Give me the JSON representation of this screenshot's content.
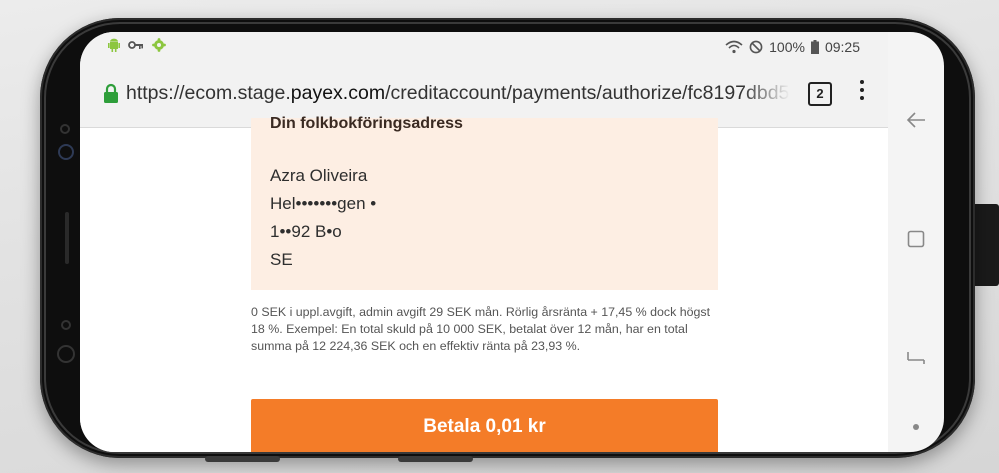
{
  "status_bar": {
    "left_icons": [
      "android-icon",
      "key-icon",
      "settings-icon"
    ],
    "battery": "100%",
    "time": "09:25"
  },
  "browser": {
    "url_prefix": "https://ecom.stage.",
    "url_domain": "payex.com",
    "url_path": "/creditaccount/payments/authorize/fc8197dbd5",
    "tab_count": "2"
  },
  "address": {
    "heading": "Din folkbokföringsadress",
    "name": "Azra Oliveira",
    "street": "Hel•••••••gen •",
    "postal": "1••92 B•o",
    "country": "SE"
  },
  "terms": "0 SEK i uppl.avgift, admin avgift 29 SEK mån. Rörlig årsränta + 17,45 % dock högst 18 %. Exempel: En total skuld på 10 000 SEK, betalat över 12 mån, har en total summa på 12 224,36 SEK och en effektiv ränta på 23,93 %.",
  "pay_button": "Betala 0,01 kr",
  "colors": {
    "accent": "#f47c28",
    "card_bg": "#fdeee3",
    "lock": "#2e9e3a"
  }
}
